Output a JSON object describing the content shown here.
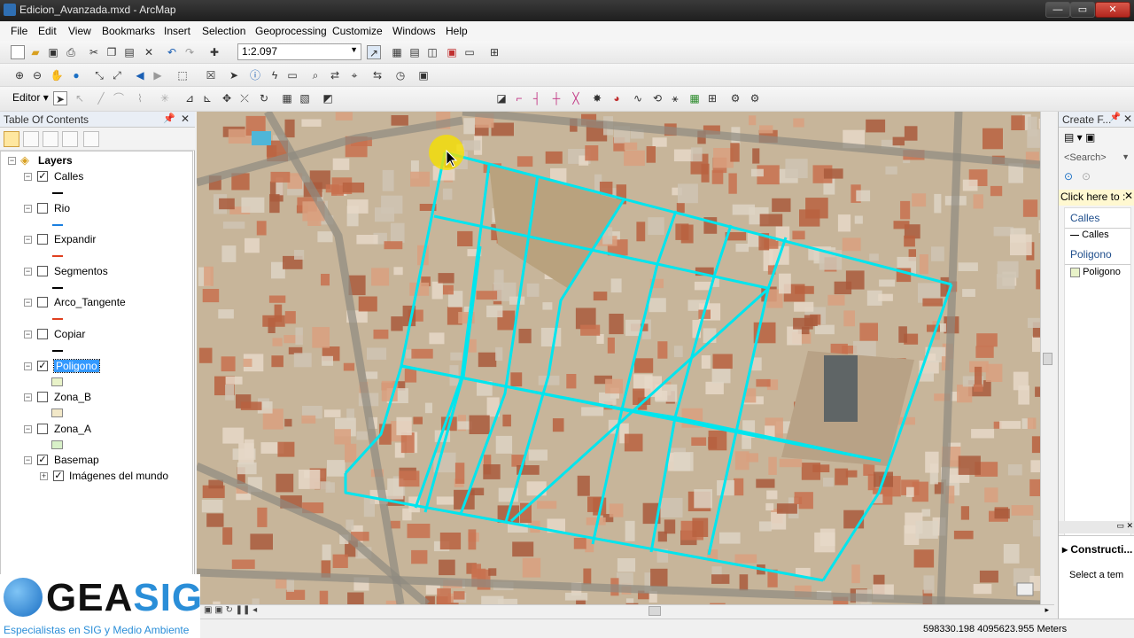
{
  "window": {
    "title": "Edicion_Avanzada.mxd - ArcMap"
  },
  "menu": [
    "File",
    "Edit",
    "View",
    "Bookmarks",
    "Insert",
    "Selection",
    "Geoprocessing",
    "Customize",
    "Windows",
    "Help"
  ],
  "toolbar": {
    "scale": "1:2.097",
    "editor_label": "Editor"
  },
  "toc": {
    "title": "Table Of Contents",
    "root": "Layers",
    "layers": [
      {
        "name": "Calles",
        "checked": true,
        "symbol": "line",
        "color": "#000000"
      },
      {
        "name": "Rio",
        "checked": false,
        "symbol": "line",
        "color": "#1a7fe0"
      },
      {
        "name": "Expandir",
        "checked": false,
        "symbol": "line",
        "color": "#e04020"
      },
      {
        "name": "Segmentos",
        "checked": false,
        "symbol": "line",
        "color": "#000000"
      },
      {
        "name": "Arco_Tangente",
        "checked": false,
        "symbol": "line",
        "color": "#e04020"
      },
      {
        "name": "Copiar",
        "checked": false,
        "symbol": "line",
        "color": "#000000"
      },
      {
        "name": "Poligono",
        "checked": true,
        "symbol": "fill",
        "color": "#e8f2c8",
        "selected": true
      },
      {
        "name": "Zona_B",
        "checked": false,
        "symbol": "fill",
        "color": "#f2e8c8"
      },
      {
        "name": "Zona_A",
        "checked": false,
        "symbol": "fill",
        "color": "#d8f0c8"
      },
      {
        "name": "Basemap",
        "checked": true,
        "symbol": "none"
      }
    ],
    "sublayer": {
      "name": "Imágenes del mundo",
      "checked": true
    }
  },
  "create_features": {
    "title": "Create F...",
    "search_placeholder": "<Search>",
    "hint": "Click here to :",
    "groups": [
      {
        "name": "Calles",
        "item": "Calles"
      },
      {
        "name": "Poligono",
        "item": "Poligono"
      }
    ],
    "construction_title": "Constructi...",
    "construction_text": "Select a tem"
  },
  "status": {
    "coords": "598330.198  4095623.955 Meters"
  },
  "logo": {
    "gea": "GEA",
    "sig": "SIG",
    "tagline": "Especialistas en SIG y Medio Ambiente"
  },
  "colors": {
    "street_lines": "#00e5ee",
    "cursor_highlight": "#f5e000"
  }
}
